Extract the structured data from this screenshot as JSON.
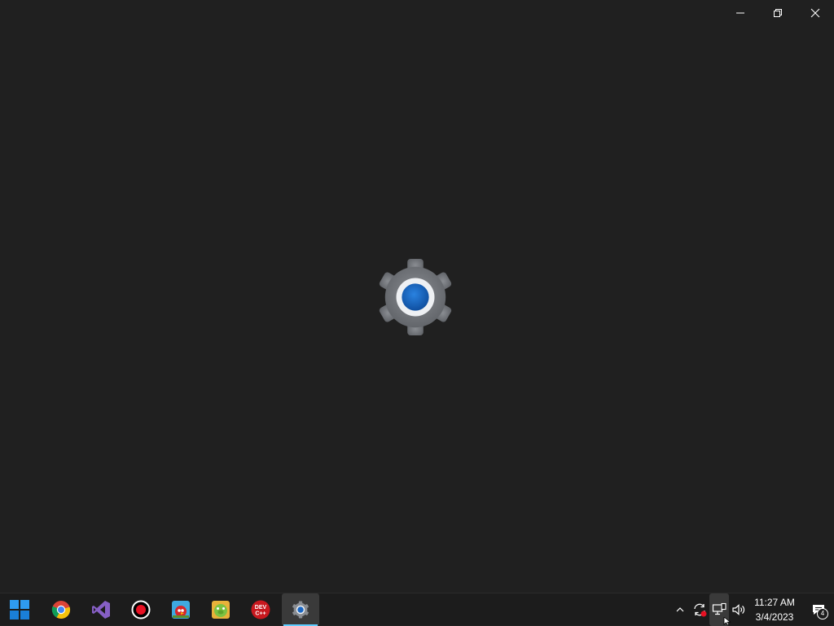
{
  "window": {
    "app_icon": "settings-gear-icon",
    "caption_buttons": [
      {
        "name": "minimize-button",
        "icon": "minimize-icon"
      },
      {
        "name": "restore-button",
        "icon": "restore-icon"
      },
      {
        "name": "close-button",
        "icon": "close-icon"
      }
    ]
  },
  "taskbar": {
    "apps": [
      {
        "name": "start-button",
        "icon": "windows-logo-icon"
      },
      {
        "name": "taskbar-app-chrome",
        "icon": "chrome-icon"
      },
      {
        "name": "taskbar-app-visual-studio",
        "icon": "visual-studio-icon"
      },
      {
        "name": "taskbar-app-recorder",
        "icon": "record-icon"
      },
      {
        "name": "taskbar-app-angry-birds",
        "icon": "angry-birds-icon"
      },
      {
        "name": "taskbar-app-bad-piggies",
        "icon": "bad-piggies-icon"
      },
      {
        "name": "taskbar-app-dev-cpp",
        "icon": "dev-cpp-icon",
        "label": "DEV C++"
      },
      {
        "name": "taskbar-app-settings",
        "icon": "settings-gear-icon",
        "active": true
      }
    ],
    "tray": {
      "icons": [
        "chevron-up-icon",
        "sync-error-icon",
        "network-icon",
        "volume-icon"
      ],
      "time": "11:27 AM",
      "date": "3/4/2023",
      "notification_count": "4"
    }
  },
  "colors": {
    "background": "#202020",
    "taskbar": "#1c1c1c",
    "accent": "#60cdff",
    "gear_grey": "#7a7d82",
    "gear_center": "#1a66c2"
  }
}
